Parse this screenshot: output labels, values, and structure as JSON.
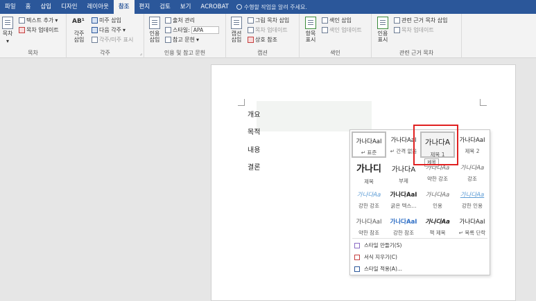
{
  "tabs": [
    "파일",
    "홈",
    "삽입",
    "디자인",
    "레이아웃",
    "참조",
    "편지",
    "검토",
    "보기",
    "ACROBAT"
  ],
  "active_tab": "참조",
  "tell_me": "수행할 작업을 알려 주세요.",
  "ribbon": {
    "toc": {
      "big": "목차",
      "add_text": "텍스트 추가",
      "update": "목차 업데이트",
      "label": "목차"
    },
    "footnotes": {
      "insert_fn": "각주 삽입",
      "ab": "AB¹",
      "insert_en": "미주 삽입",
      "next_fn": "다음 각주",
      "show": "각주/미주 표시",
      "label": "각주"
    },
    "citations": {
      "insert": "인용 삽입",
      "manage": "출처 관리",
      "style_label": "스타일:",
      "style_value": "APA",
      "bib": "참고 문헌",
      "label": "인용 및 참고 문헌"
    },
    "captions": {
      "insert": "캡션 삽입",
      "insert_tof": "그림 목차 삽입",
      "update_table": "목차 업데이트",
      "cross_ref": "상호 참조",
      "label": "캡션"
    },
    "index": {
      "mark": "항목 표시",
      "insert": "색인 삽입",
      "update": "색인 업데이트",
      "label": "색인"
    },
    "toa": {
      "mark": "인용 표시",
      "insert": "관련 근거 목차 삽입",
      "update": "목차 업데이트",
      "label": "관련 근거 목차"
    }
  },
  "document": {
    "paragraphs": [
      "개요",
      "목적",
      "내용",
      "결론"
    ]
  },
  "gallery": {
    "styles": [
      {
        "sample": "가나다AaI",
        "name": "↵ 표준"
      },
      {
        "sample": "가나다AaI",
        "name": "↵ 간격 없음"
      },
      {
        "sample": "가나다A",
        "name": "제목 1"
      },
      {
        "sample": "가나다AaI",
        "name": "제목 2"
      },
      {
        "sample": "가나디",
        "name": "제목"
      },
      {
        "sample": "가나다A",
        "name": "부제"
      },
      {
        "sample": "가나다Aa",
        "name": "약한 강조"
      },
      {
        "sample": "가나다Aa",
        "name": "강조"
      },
      {
        "sample": "가나다Aa",
        "name": "강한 강조"
      },
      {
        "sample": "가나다AaI",
        "name": "굵은 텍스..."
      },
      {
        "sample": "가나다Aa",
        "name": "인용"
      },
      {
        "sample": "가나다Aa",
        "name": "강한 인용"
      },
      {
        "sample": "가나다AaI",
        "name": "약한 참조"
      },
      {
        "sample": "가나다AaI",
        "name": "강한 참조"
      },
      {
        "sample": "가나다Aa",
        "name": "책 제목"
      },
      {
        "sample": "가나다AaI",
        "name": "↵ 목록 단락"
      }
    ],
    "menu": [
      "스타일 만들기(S)",
      "서식 지우기(C)",
      "스타일 적용(A)..."
    ],
    "tooltip": "제목"
  },
  "colors": {
    "accent": "#2b579a",
    "highlight": "#e02020"
  }
}
